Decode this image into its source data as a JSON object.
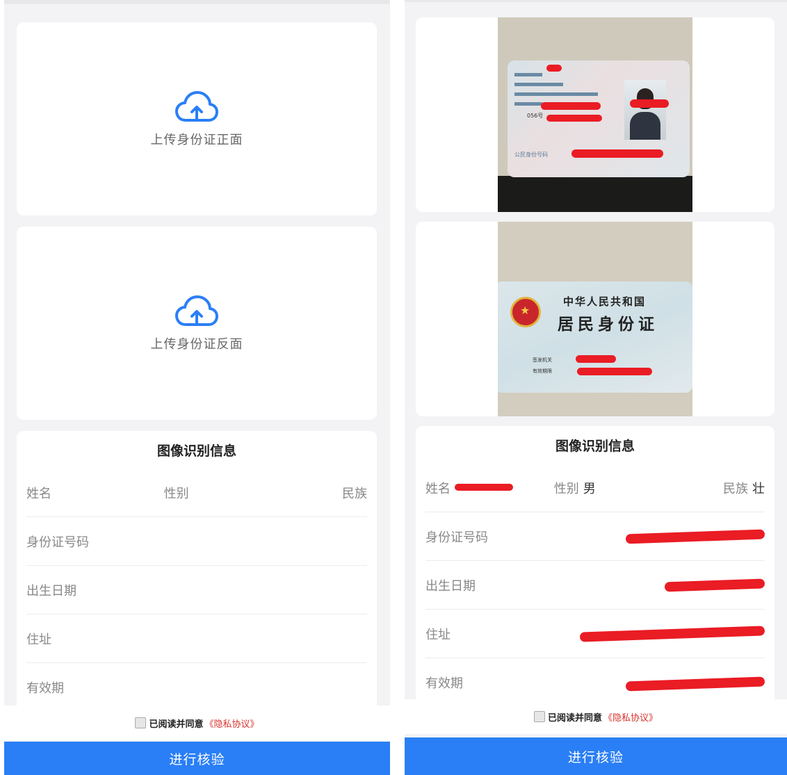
{
  "left": {
    "upload_front_label": "上传身份证正面",
    "upload_back_label": "上传身份证反面",
    "info": {
      "title": "图像识别信息",
      "name_label": "姓名",
      "gender_label": "性别",
      "ethnicity_label": "民族",
      "id_label": "身份证号码",
      "birth_label": "出生日期",
      "address_label": "住址",
      "validity_label": "有效期"
    },
    "agree_text": "已阅读并同意",
    "privacy_link": "《隐私协议》",
    "submit_label": "进行核验"
  },
  "right": {
    "front_card": {
      "number_suffix": "056号",
      "id_number_label": "公民身份号码"
    },
    "back_card": {
      "country_title": "中华人民共和国",
      "card_title": "居民身份证",
      "issuer_label": "签发机关",
      "validity_label": "有效期限"
    },
    "info": {
      "title": "图像识别信息",
      "name_label": "姓名",
      "gender_label": "性别",
      "gender_value": "男",
      "ethnicity_label": "民族",
      "ethnicity_value": "壮",
      "id_label": "身份证号码",
      "birth_label": "出生日期",
      "address_label": "住址",
      "validity_label": "有效期"
    },
    "agree_text": "已阅读并同意",
    "privacy_link": "《隐私协议》",
    "submit_label": "进行核验"
  },
  "colors": {
    "accent": "#2a7ff6",
    "link": "#d7322c",
    "redaction": "#ea1c24"
  }
}
